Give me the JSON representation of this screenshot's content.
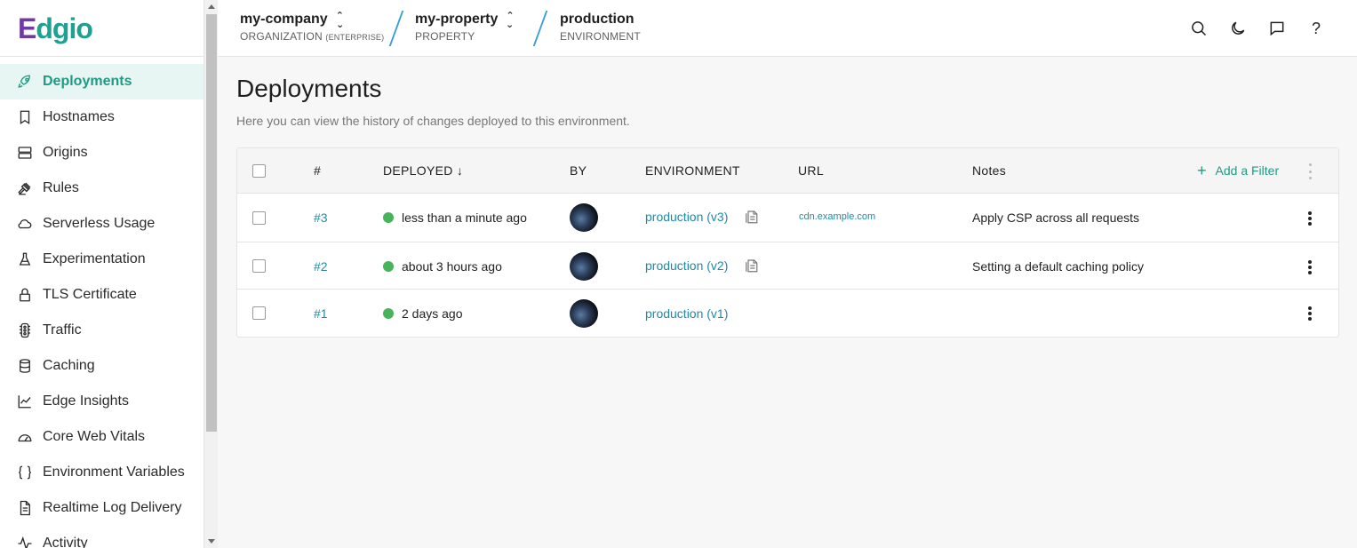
{
  "brand": {
    "logo_e": "E",
    "logo_rest": "dgio"
  },
  "sidebar": {
    "items": [
      {
        "label": "Deployments",
        "icon": "rocket-icon",
        "active": true
      },
      {
        "label": "Hostnames",
        "icon": "bookmark-icon"
      },
      {
        "label": "Origins",
        "icon": "server-icon"
      },
      {
        "label": "Rules",
        "icon": "gavel-icon"
      },
      {
        "label": "Serverless Usage",
        "icon": "cloud-icon"
      },
      {
        "label": "Experimentation",
        "icon": "flask-icon"
      },
      {
        "label": "TLS Certificate",
        "icon": "lock-icon"
      },
      {
        "label": "Traffic",
        "icon": "traffic-light-icon"
      },
      {
        "label": "Caching",
        "icon": "database-icon"
      },
      {
        "label": "Edge Insights",
        "icon": "line-chart-icon"
      },
      {
        "label": "Core Web Vitals",
        "icon": "gauge-icon"
      },
      {
        "label": "Environment Variables",
        "icon": "braces-icon"
      },
      {
        "label": "Realtime Log Delivery",
        "icon": "document-icon"
      },
      {
        "label": "Activity",
        "icon": "activity-icon"
      }
    ]
  },
  "header": {
    "org": {
      "name": "my-company",
      "label": "ORGANIZATION",
      "tier": "(ENTERPRISE)"
    },
    "property": {
      "name": "my-property",
      "label": "PROPERTY"
    },
    "environment": {
      "name": "production",
      "label": "ENVIRONMENT"
    },
    "icons": [
      "search-icon",
      "moon-icon",
      "chat-icon",
      "help-icon"
    ],
    "help_glyph": "?"
  },
  "main": {
    "title": "Deployments",
    "description": "Here you can view the history of changes deployed to this environment."
  },
  "table": {
    "columns": {
      "num": "#",
      "deployed": "DEPLOYED",
      "by": "BY",
      "environment": "ENVIRONMENT",
      "url": "URL",
      "notes": "Notes"
    },
    "add_filter": "Add a Filter",
    "rows": [
      {
        "num": "#3",
        "deployed": "less than a minute ago",
        "environment": "production (v3)",
        "url": "cdn.example.com",
        "notes": "Apply CSP across all requests"
      },
      {
        "num": "#2",
        "deployed": "about 3 hours ago",
        "environment": "production (v2)",
        "url": "",
        "notes": "Setting a default caching policy"
      },
      {
        "num": "#1",
        "deployed": "2 days ago",
        "environment": "production (v1)",
        "url": "",
        "notes": ""
      }
    ]
  },
  "colors": {
    "accent": "#1f9a84",
    "link": "#1f8aa6",
    "status_ok": "#47b35a",
    "brand_purple": "#6e3aa3"
  }
}
